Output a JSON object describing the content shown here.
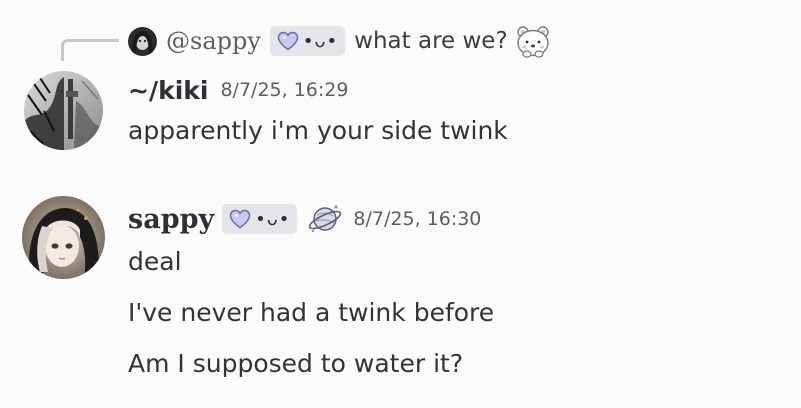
{
  "reply": {
    "username": "@sappy",
    "tag_face": "•ᴗ•",
    "text": "what are we?",
    "emoji_icon": "bear-peek-icon"
  },
  "messages": [
    {
      "username": "~/kiki",
      "timestamp": "8/7/25, 16:29",
      "lines": [
        "apparently i'm your side twink"
      ]
    },
    {
      "username": "sappy",
      "tag_face": "•ᴗ•",
      "badge_icon": "planet-icon",
      "timestamp": "8/7/25, 16:30",
      "lines": [
        "deal",
        "I've never had a twink before",
        "Am I supposed to water it?"
      ]
    }
  ],
  "colors": {
    "background": "#fbfbfb",
    "text": "#313338",
    "muted": "#5c5e66",
    "tag_bg": "#e3e5e8",
    "heart": "#b8b5f0"
  }
}
